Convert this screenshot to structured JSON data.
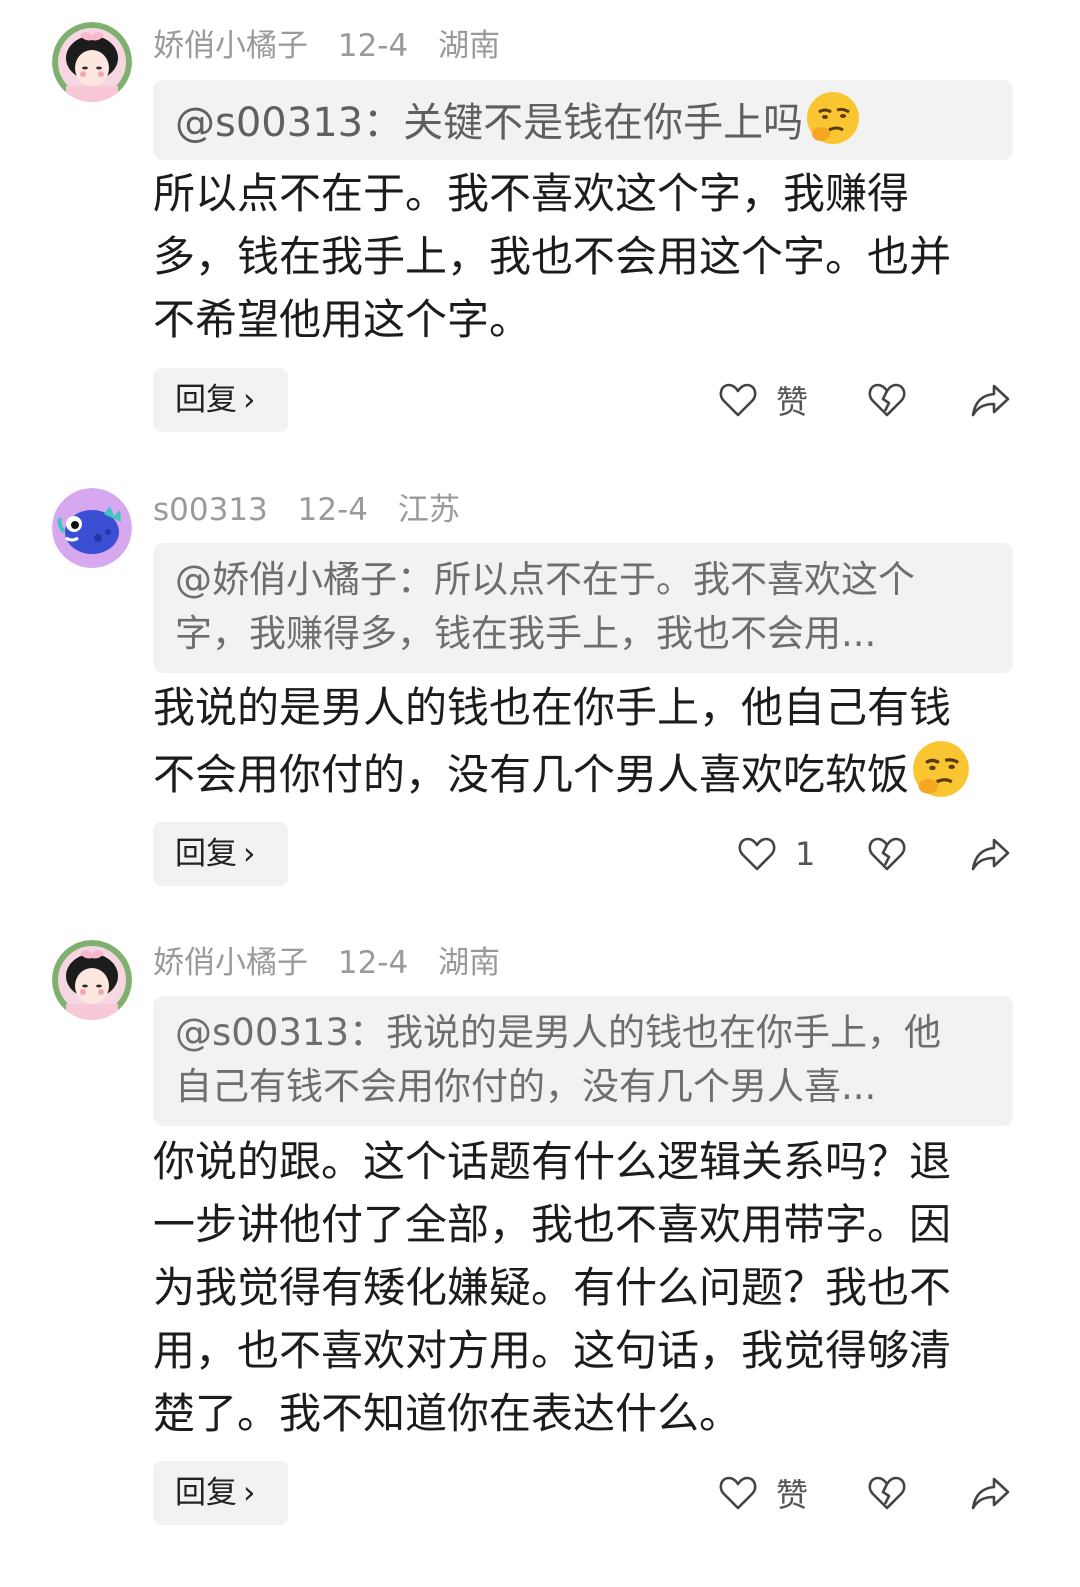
{
  "comments": [
    {
      "user": "娇俏小橘子",
      "date": "12-4",
      "location": "湖南",
      "quote_line_1": "@s00313：关键不是钱在你手上吗",
      "quote_line_2": "",
      "body_lines": [
        "所以点不在于。我不喜欢这个字，我赚得",
        "多，钱在我手上，我也不会用这个字。也并",
        "不希望他用这个字。"
      ],
      "reply_label": "回复",
      "like_label": "赞",
      "avatar_icon": "girl-avatar-icon"
    },
    {
      "user": "s00313",
      "date": "12-4",
      "location": "江苏",
      "quote_line_1": "@娇俏小橘子：所以点不在于。我不喜欢这个",
      "quote_line_2": "字，我赚得多，钱在我手上，我也不会用...",
      "body_lines": [
        "我说的是男人的钱也在你手上，他自己有钱",
        "不会用你付的，没有几个男人喜欢吃软饭"
      ],
      "reply_label": "回复",
      "like_label": "1",
      "avatar_icon": "fish-avatar-icon"
    },
    {
      "user": "娇俏小橘子",
      "date": "12-4",
      "location": "湖南",
      "quote_line_1": "@s00313：我说的是男人的钱也在你手上，他",
      "quote_line_2": "自己有钱不会用你付的，没有几个男人喜...",
      "body_lines": [
        "你说的跟。这个话题有什么逻辑关系吗？退",
        "一步讲他付了全部，我也不喜欢用带字。因",
        "为我觉得有矮化嫌疑。有什么问题？我也不",
        "用，也不喜欢对方用。这句话，我觉得够清",
        "楚了。我不知道你在表达什么。"
      ],
      "reply_label": "回复",
      "like_label": "赞",
      "avatar_icon": "girl-avatar-icon"
    }
  ],
  "icons": {
    "reply_chevron": "chevron-right-icon",
    "like": "heart-icon",
    "dislike": "broken-heart-icon",
    "share": "share-arrow-icon",
    "emoji": "thinking-smirk-emoji-icon"
  },
  "colors": {
    "meta": "#9a9a9a",
    "quote_bg": "#f2f2f2",
    "quote_text": "#6e6e6e",
    "body_text": "#1c1c1c",
    "avatar_purple": "#d7a8f0"
  }
}
